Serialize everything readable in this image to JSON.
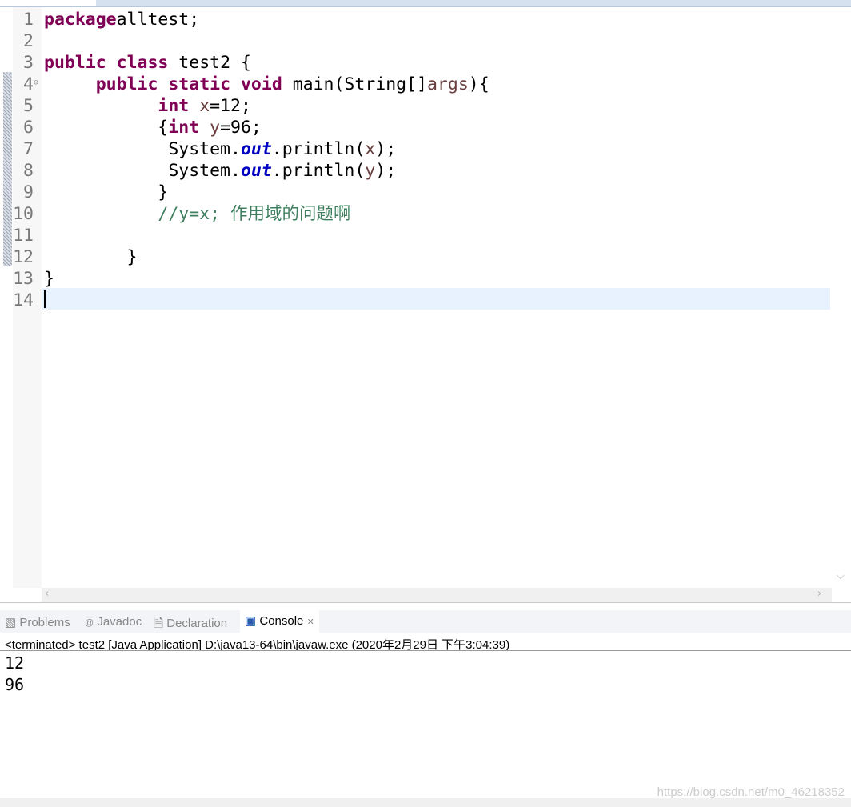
{
  "editor": {
    "lines": [
      [
        [
          "kw",
          "package"
        ],
        [
          "",
          "alltest;"
        ]
      ],
      [],
      [
        [
          "kw",
          "public"
        ],
        [
          "",
          " "
        ],
        [
          "kw",
          "class"
        ],
        [
          "",
          " test2 {"
        ]
      ],
      [
        [
          "",
          "     "
        ],
        [
          "kw",
          "public"
        ],
        [
          "",
          " "
        ],
        [
          "kw",
          "static"
        ],
        [
          "",
          " "
        ],
        [
          "kw",
          "void"
        ],
        [
          "",
          " main(String[]"
        ],
        [
          "var",
          "args"
        ],
        [
          "",
          "){"
        ]
      ],
      [
        [
          "",
          "           "
        ],
        [
          "kw",
          "int"
        ],
        [
          "",
          " "
        ],
        [
          "var",
          "x"
        ],
        [
          "",
          "=12;"
        ]
      ],
      [
        [
          "",
          "           {"
        ],
        [
          "kw",
          "int"
        ],
        [
          "",
          " "
        ],
        [
          "var",
          "y"
        ],
        [
          "",
          "=96;"
        ]
      ],
      [
        [
          "",
          "            System."
        ],
        [
          "fld",
          "out"
        ],
        [
          "",
          ".println("
        ],
        [
          "var",
          "x"
        ],
        [
          "",
          ");"
        ]
      ],
      [
        [
          "",
          "            System."
        ],
        [
          "fld",
          "out"
        ],
        [
          "",
          ".println("
        ],
        [
          "var",
          "y"
        ],
        [
          "",
          ");"
        ]
      ],
      [
        [
          "",
          "           }"
        ]
      ],
      [
        [
          "",
          "           "
        ],
        [
          "cm",
          "//y=x; 作用域的问题啊"
        ]
      ],
      [],
      [
        [
          "",
          "        }"
        ]
      ],
      [
        [
          "",
          "}"
        ]
      ],
      []
    ],
    "line_numbers": [
      "1",
      "2",
      "3",
      "4",
      "5",
      "6",
      "7",
      "8",
      "9",
      "10",
      "11",
      "12",
      "13",
      "14"
    ],
    "current_line": 14
  },
  "panel": {
    "tabs": [
      {
        "label": "Problems",
        "icon": "problems-icon"
      },
      {
        "label": "Javadoc",
        "icon": "at-icon"
      },
      {
        "label": "Declaration",
        "icon": "declaration-icon"
      },
      {
        "label": "Console",
        "icon": "console-icon",
        "active": true
      }
    ],
    "status": "<terminated> test2 [Java Application] D:\\java13-64\\bin\\javaw.exe (2020年2月29日 下午3:04:39)",
    "output": [
      "12",
      "96"
    ]
  },
  "watermark": "https://blog.csdn.net/m0_46218352"
}
